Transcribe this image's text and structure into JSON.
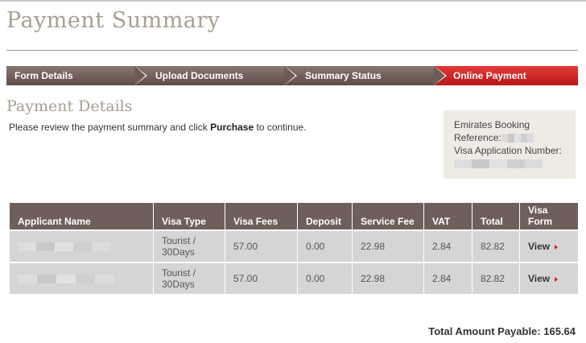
{
  "header": {
    "title": "Payment Summary"
  },
  "steps": [
    {
      "label": "Form Details",
      "active": false
    },
    {
      "label": "Upload Documents",
      "active": false
    },
    {
      "label": "Summary Status",
      "active": false
    },
    {
      "label": "Online Payment",
      "active": true
    }
  ],
  "section": {
    "title": "Payment Details",
    "instruction_before": "Please review the payment summary and click ",
    "instruction_bold": "Purchase",
    "instruction_after": " to continue."
  },
  "reference": {
    "booking_label_1": "Emirates Booking",
    "booking_label_2": "Reference:",
    "application_label": "Visa Application Number:"
  },
  "table": {
    "headers": {
      "applicant": "Applicant Name",
      "visa_type": "Visa Type",
      "visa_fees": "Visa Fees",
      "deposit": "Deposit",
      "service_fee": "Service Fee",
      "vat": "VAT",
      "total": "Total",
      "visa_form": "Visa Form"
    },
    "rows": [
      {
        "visa_type_1": "Tourist /",
        "visa_type_2": "30Days",
        "visa_fees": "57.00",
        "deposit": "0.00",
        "service_fee": "22.98",
        "vat": "2.84",
        "total": "82.82",
        "visa_form": "View"
      },
      {
        "visa_type_1": "Tourist /",
        "visa_type_2": "30Days",
        "visa_fees": "57.00",
        "deposit": "0.00",
        "service_fee": "22.98",
        "vat": "2.84",
        "total": "82.82",
        "visa_form": "View"
      }
    ]
  },
  "footer": {
    "total_label": "Total Amount Payable: 165.64"
  },
  "colors": {
    "accent": "#d02020",
    "step_bg": "#6f5b56",
    "header_bg": "#6f5f5a",
    "title": "#a8a090"
  }
}
